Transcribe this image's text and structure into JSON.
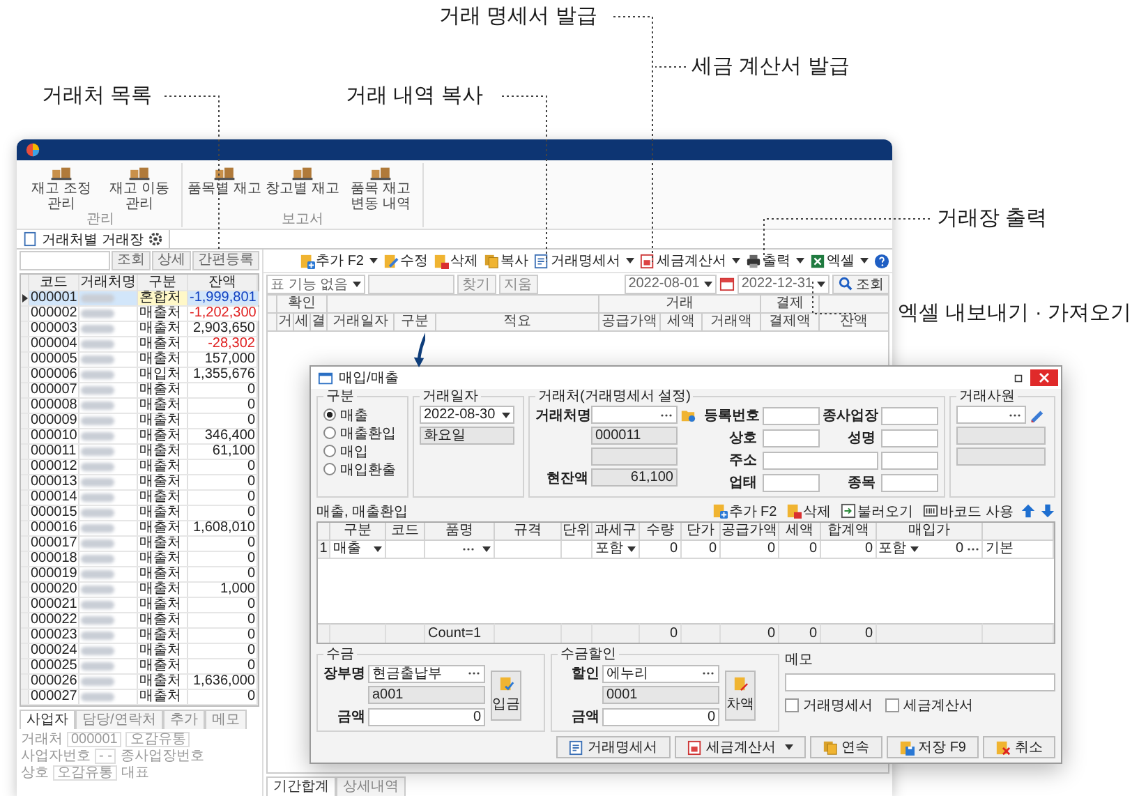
{
  "callouts": [
    {
      "text": "거래처 목록"
    },
    {
      "text": "거래 내역 복사"
    },
    {
      "text": "거래 명세서 발급"
    },
    {
      "text": "세금 계산서 발급"
    },
    {
      "text": "거래장 출력"
    },
    {
      "text": "엑셀 내보내기 · 가져오기"
    }
  ],
  "back_window": {
    "ribbon": [
      {
        "label": "관리",
        "items": [
          "재고 조정 관리",
          "재고 이동 관리"
        ]
      },
      {
        "label": "보고서",
        "items": [
          "품목별 재고",
          "창고별 재고",
          "품목 재고 변동 내역"
        ]
      }
    ],
    "doc_tab": "거래처별 거래장",
    "list": {
      "buttons": [
        "조회",
        "상세",
        "간편등록"
      ],
      "columns": [
        "코드",
        "거래처명",
        "구분",
        "잔액"
      ],
      "rows": [
        {
          "code": "000001",
          "type": "혼합처",
          "balance": "-1,999,801",
          "negative": true,
          "selected": true
        },
        {
          "code": "000002",
          "type": "매출처",
          "balance": "-1,202,300",
          "negative": true,
          "selected": false
        },
        {
          "code": "000003",
          "type": "매출처",
          "balance": "2,903,650",
          "negative": false,
          "selected": false
        },
        {
          "code": "000004",
          "type": "매출처",
          "balance": "-28,302",
          "negative": true,
          "selected": false
        },
        {
          "code": "000005",
          "type": "매출처",
          "balance": "157,000",
          "negative": false,
          "selected": false
        },
        {
          "code": "000006",
          "type": "매입처",
          "balance": "1,355,676",
          "negative": false,
          "selected": false
        },
        {
          "code": "000007",
          "type": "매출처",
          "balance": "0",
          "negative": false,
          "selected": false
        },
        {
          "code": "000008",
          "type": "매출처",
          "balance": "0",
          "negative": false,
          "selected": false
        },
        {
          "code": "000009",
          "type": "매출처",
          "balance": "0",
          "negative": false,
          "selected": false
        },
        {
          "code": "000010",
          "type": "매출처",
          "balance": "346,400",
          "negative": false,
          "selected": false
        },
        {
          "code": "000011",
          "type": "매출처",
          "balance": "61,100",
          "negative": false,
          "selected": false
        },
        {
          "code": "000012",
          "type": "매출처",
          "balance": "0",
          "negative": false,
          "selected": false
        },
        {
          "code": "000013",
          "type": "매출처",
          "balance": "0",
          "negative": false,
          "selected": false
        },
        {
          "code": "000014",
          "type": "매출처",
          "balance": "0",
          "negative": false,
          "selected": false
        },
        {
          "code": "000015",
          "type": "매출처",
          "balance": "0",
          "negative": false,
          "selected": false
        },
        {
          "code": "000016",
          "type": "매출처",
          "balance": "1,608,010",
          "negative": false,
          "selected": false
        },
        {
          "code": "000017",
          "type": "매출처",
          "balance": "0",
          "negative": false,
          "selected": false
        },
        {
          "code": "000018",
          "type": "매출처",
          "balance": "0",
          "negative": false,
          "selected": false
        },
        {
          "code": "000019",
          "type": "매출처",
          "balance": "0",
          "negative": false,
          "selected": false
        },
        {
          "code": "000020",
          "type": "매출처",
          "balance": "1,000",
          "negative": false,
          "selected": false
        },
        {
          "code": "000021",
          "type": "매출처",
          "balance": "0",
          "negative": false,
          "selected": false
        },
        {
          "code": "000022",
          "type": "매출처",
          "balance": "0",
          "negative": false,
          "selected": false
        },
        {
          "code": "000023",
          "type": "매출처",
          "balance": "0",
          "negative": false,
          "selected": false
        },
        {
          "code": "000024",
          "type": "매출처",
          "balance": "0",
          "negative": false,
          "selected": false
        },
        {
          "code": "000025",
          "type": "매출처",
          "balance": "0",
          "negative": false,
          "selected": false
        },
        {
          "code": "000026",
          "type": "매출처",
          "balance": "1,636,000",
          "negative": false,
          "selected": false
        },
        {
          "code": "000027",
          "type": "매출처",
          "balance": "0",
          "negative": false,
          "selected": false
        }
      ]
    },
    "detail_tabs": [
      {
        "label": "사업자",
        "selected": true
      },
      {
        "label": "담당/연락처",
        "selected": false
      },
      {
        "label": "추가",
        "selected": false
      },
      {
        "label": "메모",
        "selected": false
      }
    ],
    "detail_rows": [
      [
        {
          "kind": "label",
          "text": "거래처"
        },
        {
          "kind": "value",
          "text": "000001"
        },
        {
          "kind": "value",
          "text": "오감유통"
        }
      ],
      [
        {
          "kind": "label",
          "text": "사업자번호"
        },
        {
          "kind": "value",
          "text": "- -"
        },
        {
          "kind": "label",
          "text": "종사업장번호"
        }
      ],
      [
        {
          "kind": "label",
          "text": "상호"
        },
        {
          "kind": "value",
          "text": "오감유통"
        },
        {
          "kind": "label",
          "text": "대표"
        }
      ]
    ],
    "toolbar": [
      {
        "label": "추가 F2",
        "kind": "add",
        "dropdown": true
      },
      {
        "label": "수정",
        "kind": "edit",
        "dropdown": false
      },
      {
        "label": "삭제",
        "kind": "delete",
        "dropdown": false
      },
      {
        "label": "복사",
        "kind": "copy",
        "dropdown": false
      },
      {
        "label": "거래명세서",
        "kind": "statement",
        "dropdown": true
      },
      {
        "label": "세금계산서",
        "kind": "tax",
        "dropdown": true
      },
      {
        "label": "출력",
        "kind": "print",
        "dropdown": true
      },
      {
        "label": "엑셀",
        "kind": "excel",
        "dropdown": true
      }
    ],
    "filter": {
      "value": "표 기능 없음",
      "buttons": [
        "찾기",
        "지움"
      ],
      "date_from": "2022-08-01",
      "date_to": "2022-12-31",
      "search": "조회"
    },
    "grid": {
      "groups": [
        "확인",
        "거래",
        "결제"
      ],
      "columns": [
        "거",
        "세",
        "결",
        "거래일자",
        "구분",
        "적요",
        "공급가액",
        "세액",
        "거래액",
        "결제액",
        "잔액"
      ]
    },
    "bottom_tabs": [
      {
        "label": "기간합계",
        "selected": true
      },
      {
        "label": "상세내역",
        "selected": false
      }
    ]
  },
  "dialog": {
    "title": "매입/매출",
    "type_group": {
      "legend": "구분",
      "options": [
        {
          "label": "매출",
          "selected": true
        },
        {
          "label": "매출환입",
          "selected": false
        },
        {
          "label": "매입",
          "selected": false
        },
        {
          "label": "매입환출",
          "selected": false
        }
      ]
    },
    "date_group": {
      "legend": "거래일자",
      "date": "2022-08-30",
      "weekday": "화요일"
    },
    "partner_group": {
      "legend": "거래처(거래명세서 설정)",
      "name_label": "거래처명",
      "code": "000011",
      "balance_label": "현잔액",
      "balance": "61,100",
      "rows": [
        {
          "left": "등록번호",
          "right": "종사업장"
        },
        {
          "left": "상호",
          "right": "성명"
        },
        {
          "left": "주소"
        },
        {
          "left": "업태",
          "right": "종목"
        }
      ]
    },
    "staff_group": {
      "legend": "거래사원"
    },
    "grid_title": "매출, 매출환입",
    "grid_buttons": [
      {
        "label": "추가 F2",
        "kind": "add"
      },
      {
        "label": "삭제",
        "kind": "delete"
      },
      {
        "label": "불러오기",
        "kind": "load"
      },
      {
        "label": "바코드 사용",
        "kind": "barcode"
      }
    ],
    "columns": [
      "구분",
      "코드",
      "품명",
      "규격",
      "단위",
      "과세구",
      "수량",
      "단가",
      "공급가액",
      "세액",
      "합계액",
      "매입가"
    ],
    "row": {
      "number": "1",
      "cells": [
        {
          "kind": "select",
          "text": "매출"
        },
        {
          "kind": "blank"
        },
        {
          "kind": "lookup"
        },
        {
          "kind": "blank"
        },
        {
          "kind": "blank"
        },
        {
          "kind": "select",
          "text": "포함"
        },
        {
          "kind": "number",
          "text": "0"
        },
        {
          "kind": "number",
          "text": "0"
        },
        {
          "kind": "number",
          "text": "0"
        },
        {
          "kind": "number",
          "text": "0"
        },
        {
          "kind": "number",
          "text": "0"
        },
        {
          "kind": "price",
          "tax": "포함",
          "text": "0"
        },
        {
          "kind": "text",
          "text": "기본"
        }
      ]
    },
    "footer": [
      {
        "kind": "blank"
      },
      {
        "kind": "blank"
      },
      {
        "kind": "blank"
      },
      {
        "kind": "text",
        "text": "Count=1"
      },
      {
        "kind": "blank"
      },
      {
        "kind": "blank"
      },
      {
        "kind": "blank"
      },
      {
        "kind": "number",
        "text": "0"
      },
      {
        "kind": "blank"
      },
      {
        "kind": "number",
        "text": "0"
      },
      {
        "kind": "number",
        "text": "0"
      },
      {
        "kind": "number",
        "text": "0"
      },
      {
        "kind": "blank"
      },
      {
        "kind": "blank"
      }
    ],
    "receipt": {
      "legend": "수금",
      "book_label": "장부명",
      "book": "현금출납부",
      "code": "a001",
      "amount_label": "금액",
      "amount": "0",
      "button": "입금"
    },
    "discount": {
      "legend": "수금할인",
      "label": "할인",
      "value": "에누리",
      "code": "0001",
      "amount_label": "금액",
      "amount": "0",
      "button": "차액"
    },
    "memo": {
      "label": "메모",
      "checks": [
        {
          "label": "거래명세서",
          "checked": false
        },
        {
          "label": "세금계산서",
          "checked": false
        }
      ]
    },
    "buttons": [
      {
        "label": "거래명세서",
        "kind": "statement",
        "dropdown": false
      },
      {
        "label": "세금계산서",
        "kind": "tax",
        "dropdown": true
      },
      {
        "label": "연속",
        "kind": "copy",
        "dropdown": false
      },
      {
        "label": "저장 F9",
        "kind": "save",
        "dropdown": false
      },
      {
        "label": "취소",
        "kind": "cancel",
        "dropdown": false
      }
    ]
  }
}
